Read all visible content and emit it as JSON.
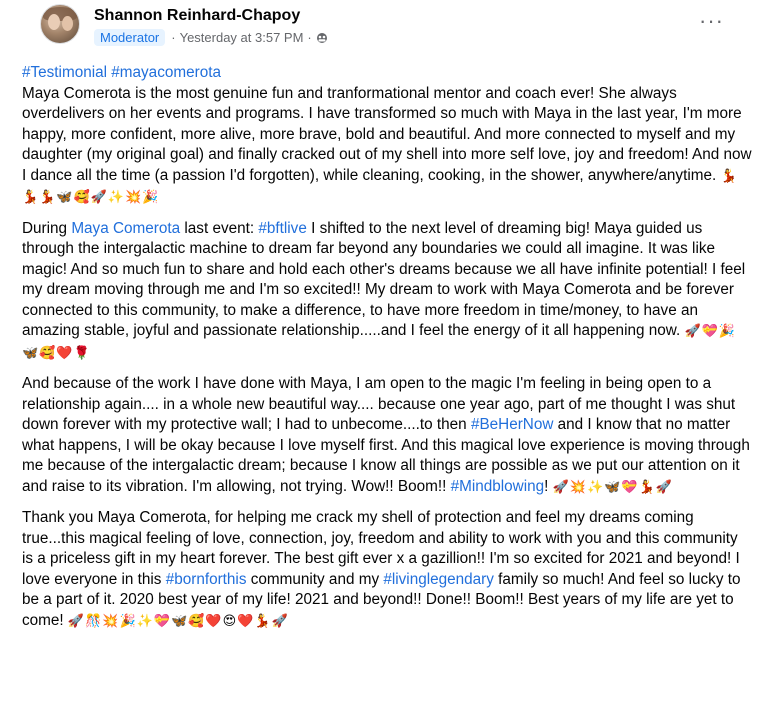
{
  "post": {
    "author": "Shannon Reinhard-Chapoy",
    "role_badge": "Moderator",
    "timestamp": "Yesterday at 3:57 PM",
    "separator": "·",
    "more_label": "···"
  },
  "body": {
    "p1": {
      "tag1": "#Testimonial",
      "tag2": "#mayacomerota",
      "text": "Maya Comerota is the most genuine fun and tranformational mentor and coach ever!  She always overdelivers on her events and programs.  I have transformed so much with Maya in the last year, I'm more happy, more confident, more alive, more brave, bold and beautiful. And more connected to myself and my daughter (my original goal) and finally cracked out of my shell into more self love, joy and freedom!  And now I dance all the time (a passion I'd forgotten), while cleaning, cooking, in the shower, anywhere/anytime.",
      "emojis": "💃💃💃🦋🥰🚀✨💥🎉"
    },
    "p2": {
      "t1": "During ",
      "mention": "Maya Comerota",
      "t2": " last event: ",
      "tag": "#bftlive",
      "t3": " I shifted to the next level of dreaming big!  Maya guided us through the intergalactic machine to dream far beyond any boundaries we could all imagine.  It was like magic!  And so much fun to share and hold each other's dreams because we all have infinite potential!  I feel my dream moving through me and I'm so excited!!  My dream to work with Maya Comerota and be forever connected to this community, to make a difference, to have more freedom in time/money, to have an amazing stable, joyful and passionate relationship.....and I feel the energy of it all happening now.",
      "emojis": "🚀💝🎉🦋🥰❤️🌹"
    },
    "p3": {
      "t1": "And because of the work I have done with Maya, I am open to the magic I'm feeling in being open to a relationship again.... in a whole new beautiful way.... because one year ago, part of me thought I was shut down forever with my protective wall; I had to unbecome....to then ",
      "tag1": "#BeHerNow",
      "t2": " and I know that no matter what happens, I will be okay because I love myself first. And this magical love experience is moving through me because of the intergalactic dream; because I know all things are possible as we put our attention on it and raise to its vibration.  I'm allowing, not trying. Wow!! Boom!! ",
      "tag2": "#Mindblowing",
      "t3": "!",
      "emojis": "🚀💥✨🦋💝💃🚀"
    },
    "p4": {
      "t1": "Thank you Maya Comerota, for helping me crack my shell of protection and feel my dreams coming true...this magical feeling of love, connection, joy, freedom and ability to work with you and this community is a priceless gift in my heart forever.  The best gift ever x a gazillion!!  I'm so excited for 2021 and beyond!  I love everyone in this ",
      "tag1": "#bornforthis",
      "t2": " community and my ",
      "tag2": "#livinglegendary",
      "t3": " family so much!  And feel so lucky to be a part of it.  2020 best year of my life! 2021 and beyond!! Done!! Boom!! Best years of my life are yet to come!",
      "emojis": "🚀🎊💥🎉✨💝🦋🥰❤️😍❤️💃🚀"
    }
  },
  "colors": {
    "link": "#216fdb",
    "badge_bg": "#e7f3ff",
    "badge_text": "#1b74e4",
    "meta": "#65676b"
  }
}
